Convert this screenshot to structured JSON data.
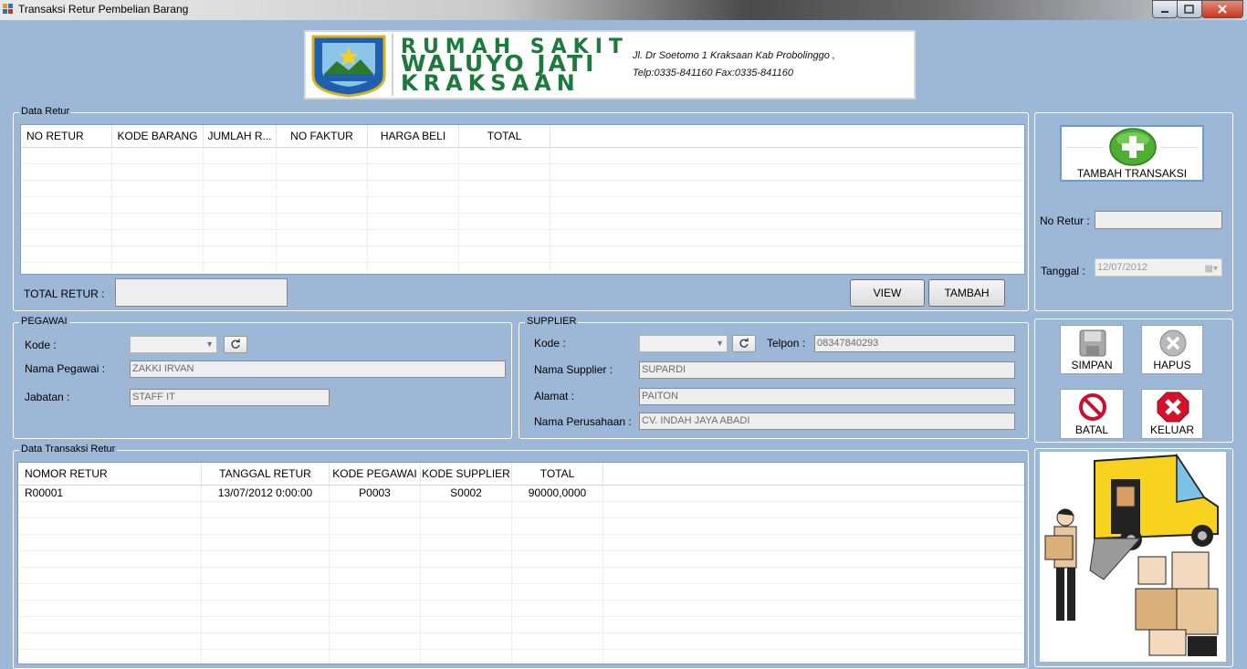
{
  "window": {
    "title": "Transaksi Retur Pembelian Barang"
  },
  "header": {
    "line1": "RUMAH SAKIT",
    "line2": "WALUYO JATI",
    "line3": "KRAKSAAN",
    "address": "Jl. Dr Soetomo 1 Kraksaan Kab Probolinggo ,",
    "phone": "Telp:0335-841160 Fax:0335-841160"
  },
  "data_retur": {
    "title": "Data Retur",
    "columns": [
      "NO RETUR",
      "KODE BARANG",
      "JUMLAH R...",
      "NO FAKTUR",
      "HARGA BELI",
      "TOTAL"
    ],
    "total_label": "TOTAL RETUR :",
    "total_value": "",
    "view_label": "VIEW",
    "tambah_label": "TAMBAH"
  },
  "pegawai": {
    "title": "PEGAWAI",
    "kode_label": "Kode :",
    "kode_value": "",
    "nama_label": "Nama Pegawai :",
    "nama_value": "ZAKKI IRVAN",
    "jabatan_label": "Jabatan :",
    "jabatan_value": "STAFF IT"
  },
  "supplier": {
    "title": "SUPPLIER",
    "kode_label": "Kode :",
    "kode_value": "",
    "telpon_label": "Telpon :",
    "telpon_value": "08347840293",
    "nama_label": "Nama Supplier :",
    "nama_value": "SUPARDI",
    "alamat_label": "Alamat :",
    "alamat_value": "PAITON",
    "perusahaan_label": "Nama Perusahaan :",
    "perusahaan_value": "CV. INDAH JAYA ABADI"
  },
  "transaksi": {
    "title": "Data Transaksi Retur",
    "columns": [
      "NOMOR RETUR",
      "TANGGAL RETUR",
      "KODE PEGAWAI",
      "KODE SUPPLIER",
      "TOTAL"
    ],
    "rows": [
      [
        "R00001",
        "13/07/2012 0:00:00",
        "P0003",
        "S0002",
        "90000,0000"
      ]
    ]
  },
  "side": {
    "tambah_transaksi": "TAMBAH TRANSAKSI",
    "no_retur_label": "No Retur :",
    "no_retur_value": "",
    "tanggal_label": "Tanggal :",
    "tanggal_value": "12/07/2012",
    "simpan": "SIMPAN",
    "hapus": "HAPUS",
    "batal": "BATAL",
    "keluar": "KELUAR"
  },
  "colors": {
    "form_bg": "#9db7d6",
    "add_green": "#4caf32",
    "cancel_red": "#c8102e"
  },
  "icons": [
    "app-icon",
    "minimize-icon",
    "maximize-icon",
    "close-icon",
    "refresh-icon",
    "add-icon",
    "calendar-icon",
    "save-icon",
    "delete-icon",
    "cancel-icon",
    "exit-icon"
  ]
}
